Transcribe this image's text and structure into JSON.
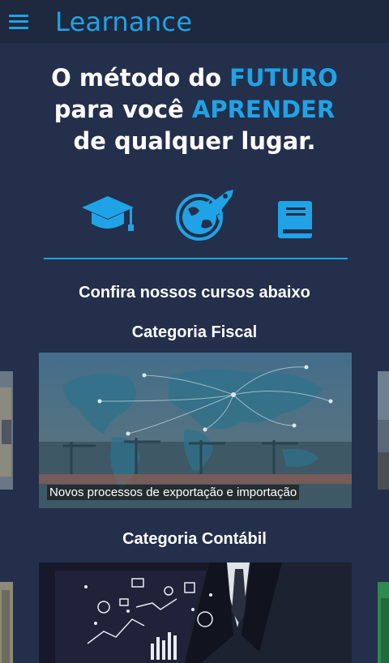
{
  "app": {
    "title": "Learnance"
  },
  "hero": {
    "line1_pre": "O método do ",
    "line1_accent": "FUTURO",
    "line2_pre": "para você ",
    "line2_accent": "APRENDER",
    "line3": "de qualquer lugar."
  },
  "icons": [
    "graduation-cap-icon",
    "globe-rocket-icon",
    "book-icon"
  ],
  "courses_heading": "Confira nossos cursos abaixo",
  "categories": [
    {
      "title": "Categoria Fiscal",
      "card_caption": "Novos processos de exportação e importação"
    },
    {
      "title": "Categoria Contábil",
      "card_caption": ""
    }
  ],
  "colors": {
    "accent": "#1fa3e6",
    "background": "#232f4b",
    "topbar": "#1e283f"
  }
}
